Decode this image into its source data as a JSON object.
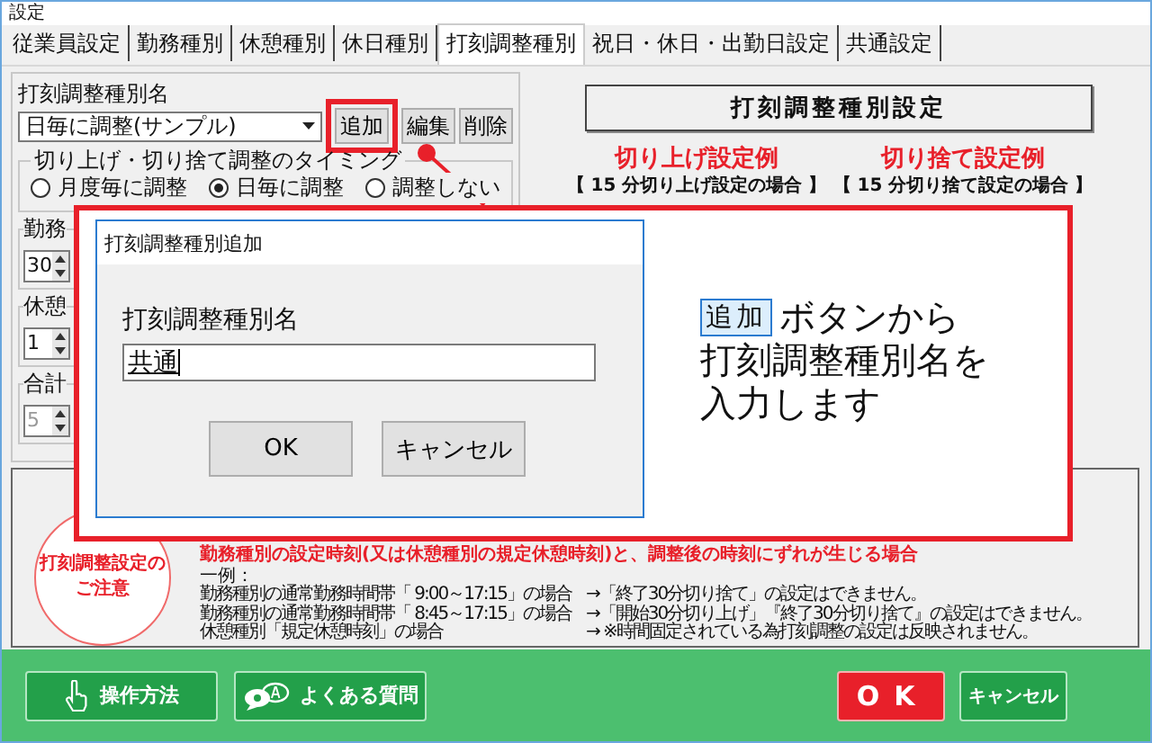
{
  "window": {
    "title": "設定"
  },
  "tabs": [
    {
      "label": "従業員設定",
      "selected": false
    },
    {
      "label": "勤務種別",
      "selected": false
    },
    {
      "label": "休憩種別",
      "selected": false
    },
    {
      "label": "休日種別",
      "selected": false
    },
    {
      "label": "打刻調整種別",
      "selected": true
    },
    {
      "label": "祝日・休日・出勤日設定",
      "selected": false
    },
    {
      "label": "共通設定",
      "selected": false
    }
  ],
  "adjust_type": {
    "label": "打刻調整種別名",
    "value": "日毎に調整(サンプル)",
    "buttons": [
      {
        "label": "追加",
        "highlighted": true
      },
      {
        "label": "編集",
        "highlighted": false
      },
      {
        "label": "削除",
        "highlighted": false
      }
    ]
  },
  "timing": {
    "title": "切り上げ・切り捨て調整のタイミング",
    "options": [
      {
        "label": "月度毎に調整",
        "selected": false
      },
      {
        "label": "日毎に調整",
        "selected": true
      },
      {
        "label": "調整しない",
        "selected": false
      }
    ]
  },
  "spinners": [
    {
      "label": "勤務",
      "value": "30",
      "disabled": false
    },
    {
      "label": "休憩",
      "value": "1",
      "disabled": false
    },
    {
      "label": "合計",
      "value": "5",
      "disabled": true
    }
  ],
  "settings": {
    "heading": "打刻調整種別設定",
    "examples": [
      {
        "title": "切り上げ設定例",
        "subtitle": "【 15 分切り上げ設定の場合 】"
      },
      {
        "title": "切り捨て設定例",
        "subtitle": "【 15 分切り捨て設定の場合 】"
      }
    ]
  },
  "notice": {
    "badge_lines": [
      "打刻調整設定の",
      "ご注意"
    ],
    "warning": "勤務種別の設定時刻(又は休憩種別の規定休憩時刻)と、調整後の時刻にずれが生じる場合",
    "example_label": "一例：",
    "examples": [
      {
        "condition": "勤務種別の通常勤務時間帯「 9:00～17:15」の場合",
        "result": "→「終了30分切り捨て」の設定はできません。"
      },
      {
        "condition": "勤務種別の通常勤務時間帯「 8:45～17:15」の場合",
        "result": "→「開始30分切り上げ」『終了30分切り捨て』の設定はできません。"
      },
      {
        "condition": "休憩種別「規定休憩時刻」の場合",
        "result": "→ ※時間固定されている為打刻調整の設定は反映されません。"
      }
    ]
  },
  "callout": {
    "dialog": {
      "title": "打刻調整種別追加",
      "field_label": "打刻調整種別名",
      "field_value": "共通",
      "buttons": [
        "OK",
        "キャンセル"
      ]
    },
    "key": "追加",
    "lines": [
      "ボタンから",
      "打刻調整種別名を",
      "入力します"
    ]
  },
  "footer": {
    "help_buttons": [
      {
        "label": "操作方法",
        "kind": "hand"
      },
      {
        "label": "よくある質問",
        "kind": "chat"
      }
    ],
    "ok": "OK",
    "cancel": "キャンセル"
  }
}
